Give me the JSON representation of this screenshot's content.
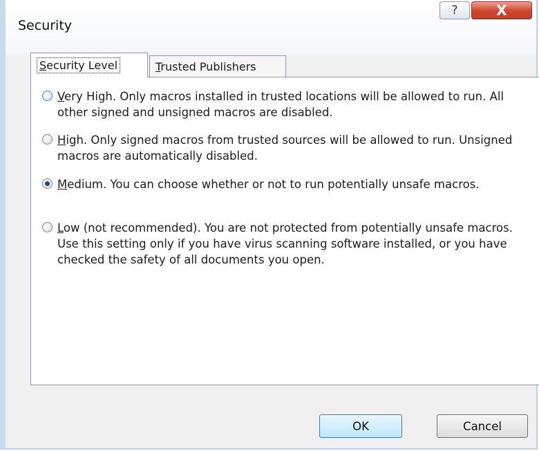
{
  "window": {
    "title": "Security",
    "help_label": "?",
    "close_label": "X"
  },
  "tabs": [
    {
      "label": "Security Level",
      "accel": "S",
      "rest": "ecurity Level",
      "selected": true
    },
    {
      "label": "Trusted Publishers",
      "accel": "T",
      "rest": "rusted Publishers",
      "selected": false
    }
  ],
  "options": [
    {
      "accel": "V",
      "text_rest": "ery High. Only macros installed in trusted locations will be allowed to run. All other signed and unsigned macros are disabled.",
      "checked": false
    },
    {
      "accel": "H",
      "text_rest": "igh. Only signed macros from trusted sources will be allowed to run. Unsigned macros are automatically disabled.",
      "checked": false
    },
    {
      "accel": "M",
      "text_rest": "edium. You can choose whether or not to run potentially unsafe macros.",
      "checked": true
    },
    {
      "accel": "L",
      "text_rest": "ow (not recommended). You are not protected from potentially unsafe macros. Use this setting only if you have virus scanning software installed, or you have checked the safety of all documents you open.",
      "checked": false
    }
  ],
  "buttons": {
    "ok": "OK",
    "cancel": "Cancel"
  }
}
